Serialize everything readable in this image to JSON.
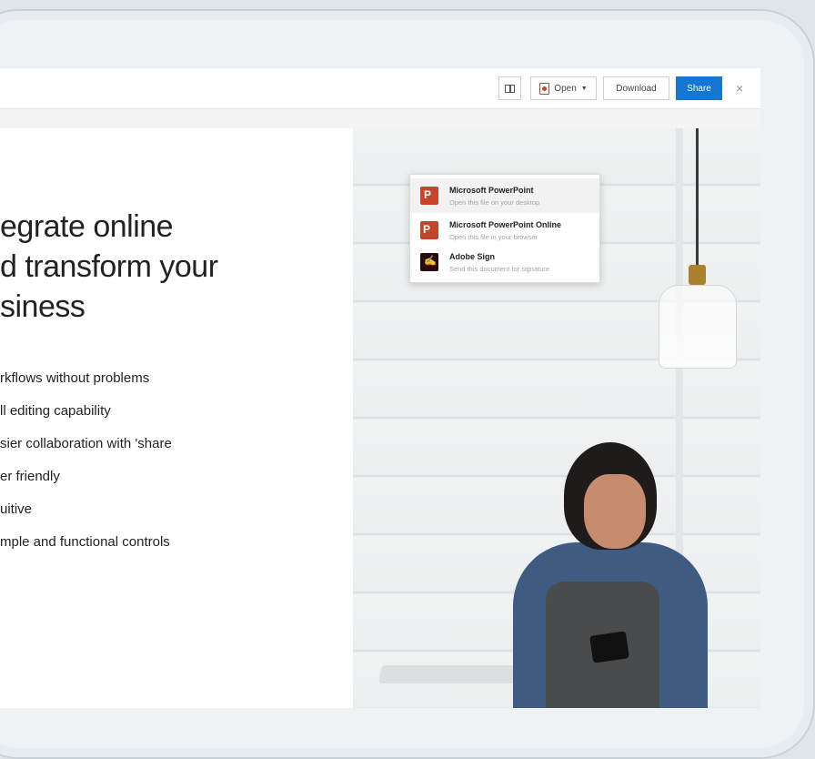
{
  "toolbar": {
    "open_label": "Open",
    "download_label": "Download",
    "share_label": "Share",
    "close_glyph": "×"
  },
  "open_menu": [
    {
      "title": "Microsoft PowerPoint",
      "subtitle": "Open this file on your desktop",
      "icon": "powerpoint-icon",
      "selected": true
    },
    {
      "title": "Microsoft PowerPoint Online",
      "subtitle": "Open this file in your browser",
      "icon": "powerpoint-online-icon",
      "selected": false
    },
    {
      "title": "Adobe Sign",
      "subtitle": "Send this document for signature",
      "icon": "adobe-sign-icon",
      "selected": false
    }
  ],
  "slide": {
    "headline": [
      "egrate online",
      "d transform your",
      "siness"
    ],
    "bullets": [
      "rkflows without problems",
      "ll editing capability",
      "sier collaboration with 'share",
      "er friendly",
      "uitive",
      "mple and functional controls"
    ]
  },
  "colors": {
    "accent": "#1677d2",
    "powerpoint": "#c4452a"
  }
}
